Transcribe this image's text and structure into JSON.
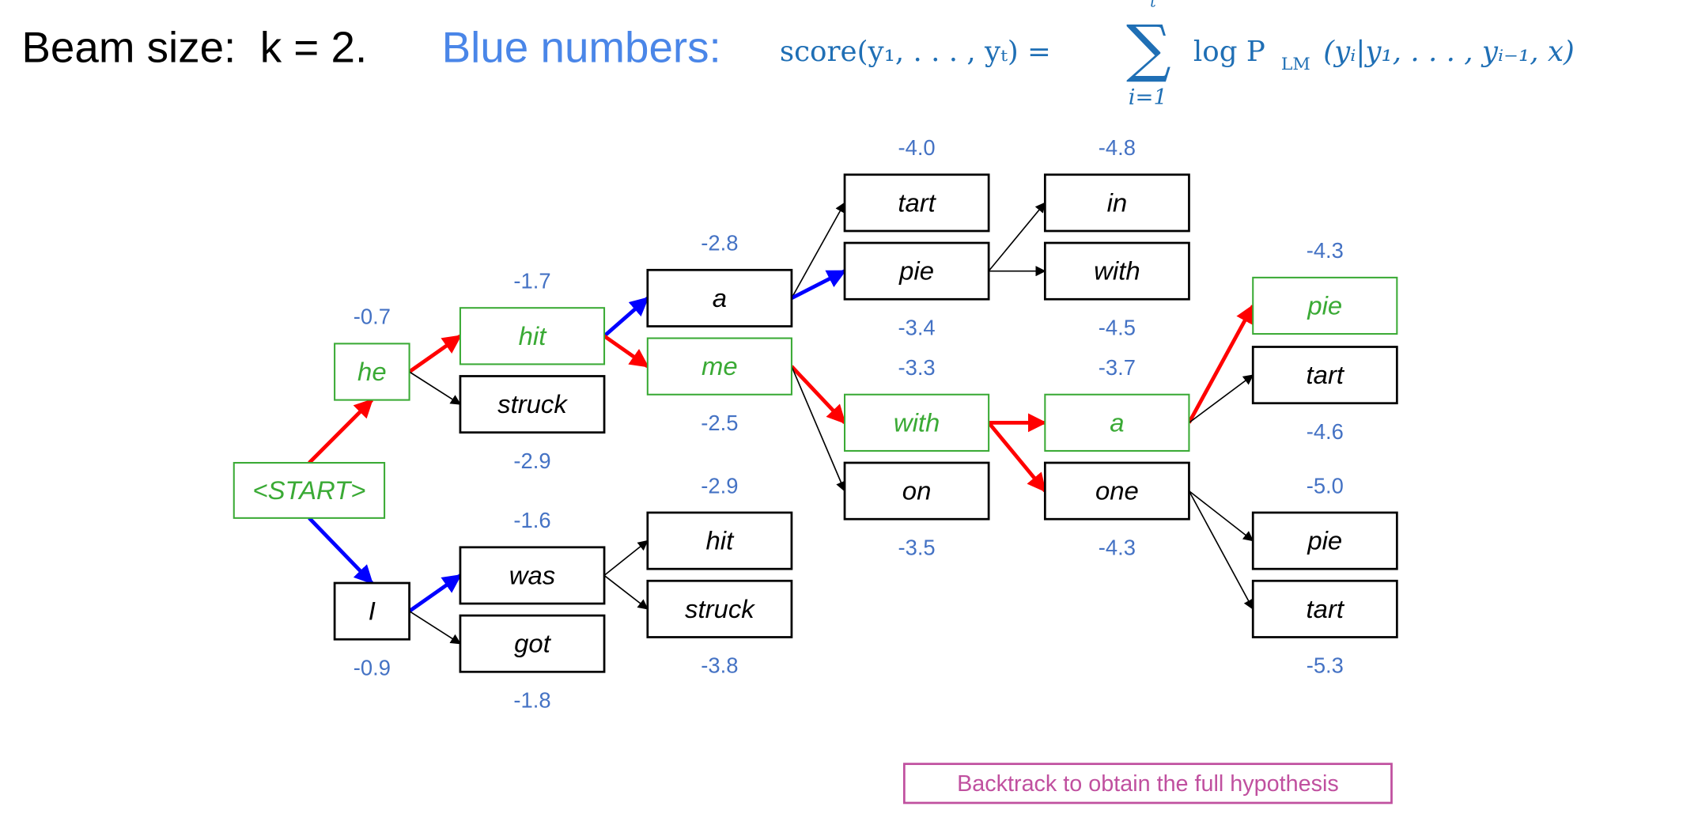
{
  "header": {
    "beam_label": "Beam size:  k = 2.",
    "blue_label": "Blue numbers:",
    "formula": {
      "lhs": "score(y₁, . . . , yₜ) =",
      "sigma": "∑",
      "sigma_upper": "t",
      "sigma_lower": "i=1",
      "rhs_log": "log P",
      "rhs_sub": "LM",
      "rhs_args": "(yᵢ|y₁, . . . , yᵢ₋₁, x)"
    }
  },
  "colors": {
    "selected_node": "#3aaa35",
    "normal_node": "#000000",
    "score_text": "#4472c4",
    "title_blue": "#4a86e8",
    "formula_blue": "#1f6fb5",
    "backtrack_edge": "#ff0000",
    "beam_edge": "#0000ff",
    "other_edge": "#000000",
    "note": "#c0509f"
  },
  "nodes": [
    {
      "id": "start",
      "label": "<START>",
      "score": "",
      "selected": true
    },
    {
      "id": "he",
      "label": "he",
      "score": "-0.7",
      "selected": true
    },
    {
      "id": "I",
      "label": "I",
      "score": "-0.9",
      "selected": false
    },
    {
      "id": "hit1",
      "label": "hit",
      "score": "-1.7",
      "selected": true
    },
    {
      "id": "struck1",
      "label": "struck",
      "score": "-2.9",
      "selected": false
    },
    {
      "id": "was",
      "label": "was",
      "score": "-1.6",
      "selected": false
    },
    {
      "id": "got",
      "label": "got",
      "score": "-1.8",
      "selected": false
    },
    {
      "id": "a1",
      "label": "a",
      "score": "-2.8",
      "selected": false
    },
    {
      "id": "me",
      "label": "me",
      "score": "-2.5",
      "selected": true
    },
    {
      "id": "hit2",
      "label": "hit",
      "score": "-2.9",
      "selected": false
    },
    {
      "id": "struck2",
      "label": "struck",
      "score": "-3.8",
      "selected": false
    },
    {
      "id": "tart1",
      "label": "tart",
      "score": "-4.0",
      "selected": false
    },
    {
      "id": "pie1",
      "label": "pie",
      "score": "-3.4",
      "selected": false
    },
    {
      "id": "with1",
      "label": "with",
      "score": "-3.3",
      "selected": true
    },
    {
      "id": "on",
      "label": "on",
      "score": "-3.5",
      "selected": false
    },
    {
      "id": "in",
      "label": "in",
      "score": "-4.8",
      "selected": false
    },
    {
      "id": "with2",
      "label": "with",
      "score": "-4.5",
      "selected": false
    },
    {
      "id": "a2",
      "label": "a",
      "score": "-3.7",
      "selected": true
    },
    {
      "id": "one",
      "label": "one",
      "score": "-4.3",
      "selected": false
    },
    {
      "id": "pie2",
      "label": "pie",
      "score": "-4.3",
      "selected": true
    },
    {
      "id": "tart2",
      "label": "tart",
      "score": "-4.6",
      "selected": false
    },
    {
      "id": "pie3",
      "label": "pie",
      "score": "-5.0",
      "selected": false
    },
    {
      "id": "tart3",
      "label": "tart",
      "score": "-5.3",
      "selected": false
    }
  ],
  "edges": [
    {
      "from": "start",
      "to": "he",
      "kind": "backtrack"
    },
    {
      "from": "start",
      "to": "I",
      "kind": "beam"
    },
    {
      "from": "he",
      "to": "hit1",
      "kind": "backtrack"
    },
    {
      "from": "he",
      "to": "struck1",
      "kind": "other"
    },
    {
      "from": "I",
      "to": "was",
      "kind": "beam"
    },
    {
      "from": "I",
      "to": "got",
      "kind": "other"
    },
    {
      "from": "hit1",
      "to": "a1",
      "kind": "beam"
    },
    {
      "from": "hit1",
      "to": "me",
      "kind": "backtrack"
    },
    {
      "from": "was",
      "to": "hit2",
      "kind": "other"
    },
    {
      "from": "was",
      "to": "struck2",
      "kind": "other"
    },
    {
      "from": "a1",
      "to": "tart1",
      "kind": "other"
    },
    {
      "from": "a1",
      "to": "pie1",
      "kind": "beam"
    },
    {
      "from": "me",
      "to": "with1",
      "kind": "backtrack"
    },
    {
      "from": "me",
      "to": "on",
      "kind": "other"
    },
    {
      "from": "pie1",
      "to": "in",
      "kind": "other"
    },
    {
      "from": "pie1",
      "to": "with2",
      "kind": "other"
    },
    {
      "from": "with1",
      "to": "a2",
      "kind": "backtrack"
    },
    {
      "from": "with1",
      "to": "one",
      "kind": "backtrack"
    },
    {
      "from": "a2",
      "to": "pie2",
      "kind": "backtrack"
    },
    {
      "from": "a2",
      "to": "tart2",
      "kind": "other"
    },
    {
      "from": "one",
      "to": "pie3",
      "kind": "other"
    },
    {
      "from": "one",
      "to": "tart3",
      "kind": "other"
    }
  ],
  "note": "Backtrack to obtain the full hypothesis"
}
